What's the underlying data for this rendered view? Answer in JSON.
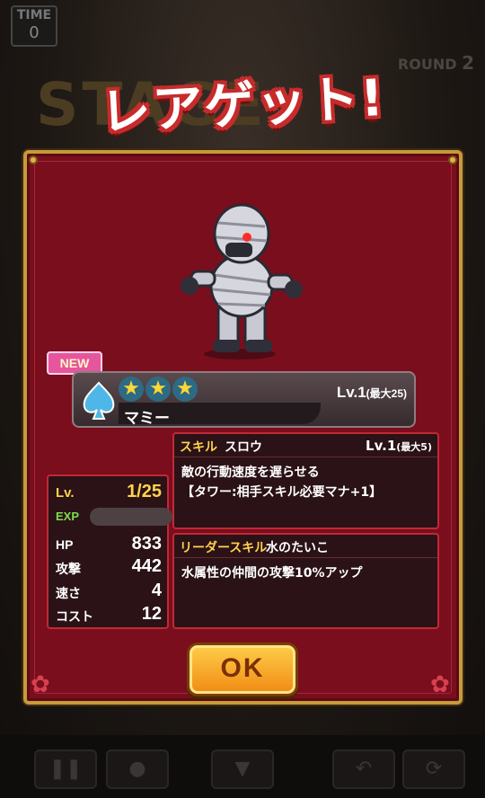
{
  "hud": {
    "time_label": "TIME",
    "time_value": "0",
    "round_label": "ROUND",
    "round_value": "2",
    "stage_clear_text": "STAGE CLEAR!"
  },
  "dialog": {
    "title": "レアゲット!",
    "new_badge": "NEW",
    "element_icon": "water-spade-icon",
    "rarity_stars": 3,
    "level_text": "Lv.1",
    "level_max": "(最大25)",
    "monster_name": "マミー",
    "stats": {
      "lv_label": "Lv.",
      "lv_value": "1/25",
      "exp_label": "EXP",
      "hp_label": "HP",
      "hp_value": "833",
      "atk_label": "攻撃",
      "atk_value": "442",
      "spd_label": "速さ",
      "spd_value": "4",
      "cost_label": "コスト",
      "cost_value": "12"
    },
    "skill": {
      "label": "スキル",
      "name": "スロウ",
      "level": "Lv.1",
      "level_max": "(最大5)",
      "desc_line1": "敵の行動速度を遅らせる",
      "desc_line2": "【タワー:相手スキル必要マナ+1】"
    },
    "leader_skill": {
      "label": "リーダースキル",
      "name": "水のたいこ",
      "desc": "水属性の仲間の攻撃10%アップ"
    },
    "ok_label": "OK"
  },
  "colors": {
    "panel_bg": "#7a0e1d",
    "panel_border": "#c79a3a",
    "accent_red": "#c12936",
    "title_outline": "#c72b2b",
    "ok_button": "#f5a623"
  }
}
